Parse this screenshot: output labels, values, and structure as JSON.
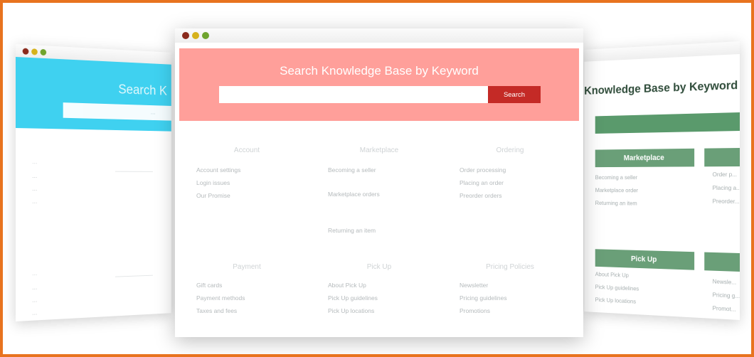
{
  "left_window": {
    "title": "Search K",
    "search_placeholder": "...",
    "sections": [
      {
        "heading": "...",
        "items": [
          "...",
          "...",
          "..."
        ]
      },
      {
        "heading": "...",
        "items": [
          "...",
          "...",
          "..."
        ]
      }
    ]
  },
  "center_window": {
    "banner_title": "Search Knowledge Base by Keyword",
    "search_value": "",
    "search_button": "Search",
    "categories": [
      {
        "heading": "Account",
        "items": [
          "Account settings",
          "Login issues",
          "Our Promise"
        ]
      },
      {
        "heading": "Marketplace",
        "items": [
          "Becoming a seller",
          "Marketplace orders",
          "Returning an item"
        ]
      },
      {
        "heading": "Ordering",
        "items": [
          "Order processing",
          "Placing an order",
          "Preorder orders"
        ]
      },
      {
        "heading": "Payment",
        "items": [
          "Gift cards",
          "Payment methods",
          "Taxes and fees"
        ]
      },
      {
        "heading": "Pick Up",
        "items": [
          "About Pick Up",
          "Pick Up guidelines",
          "Pick Up locations"
        ]
      },
      {
        "heading": "Pricing Policies",
        "items": [
          "Newsletter",
          "Pricing guidelines",
          "Promotions"
        ]
      }
    ]
  },
  "right_window": {
    "banner_title": "Knowledge Base by Keyword",
    "sections": [
      {
        "heading": "Marketplace",
        "items": [
          "Becoming a seller",
          "Marketplace order",
          "Returning an item"
        ]
      },
      {
        "heading": "Pick Up",
        "items": [
          "About Pick Up",
          "Pick Up guidelines",
          "Pick Up locations"
        ]
      }
    ],
    "partial_items_top": [
      "Order p...",
      "Placing a...",
      "Preorder..."
    ],
    "partial_items_bottom": [
      "Newsle...",
      "Pricing g...",
      "Promot..."
    ]
  },
  "colors": {
    "frame": "#e8731f",
    "center_banner": "#ff9f9a",
    "center_button": "#c42a26",
    "left_banner": "#3fd1f0",
    "right_accent": "#6a9f78"
  }
}
